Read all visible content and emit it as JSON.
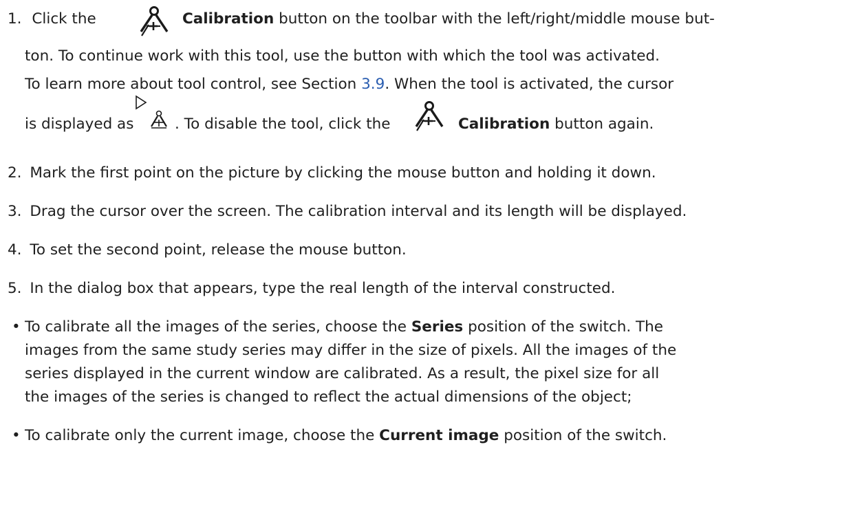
{
  "steps": [
    {
      "number": "1.",
      "line1_pre": "Click the",
      "line1_bold": "Calibration",
      "line1_post": "button on the toolbar with the left/right/middle mouse but-",
      "line2": "ton.  To continue work with this tool, use the button with which the tool was activated.",
      "line3_pre": "To learn more about tool control, see Section",
      "line3_link": "3.9",
      "line3_post": ". When the tool is activated, the cursor",
      "line4_pre": "is displayed as",
      "line4_mid": ". To disable the tool, click the",
      "line4_bold": "Calibration",
      "line4_post": "button again."
    },
    {
      "number": "2.",
      "text": "Mark the first point on the picture by clicking the mouse button and holding it down."
    },
    {
      "number": "3.",
      "text": "Drag the cursor over the screen. The calibration interval and its length will be displayed."
    },
    {
      "number": "4.",
      "text": "To set the second point, release the mouse button."
    },
    {
      "number": "5.",
      "text": "In the dialog box that appears, type the real length of the interval constructed."
    }
  ],
  "bullets": [
    {
      "marker": "•",
      "l1_pre": "To calibrate all the images of the series, choose the",
      "l1_bold": "Series",
      "l1_post": "position of the switch.  The",
      "l2": "images from the same study series may differ in the size of pixels.  All the images of the",
      "l3": "series displayed in the current window are calibrated.  As a result, the pixel size for all",
      "l4": "the images of the series is changed to reflect the actual dimensions of the object;"
    },
    {
      "marker": "•",
      "l1_pre": "To calibrate only the current image, choose the",
      "l1_bold": "Current image",
      "l1_post": "position of the switch."
    }
  ],
  "icons": {
    "calibration": "calibration-icon",
    "cursor": "calibration-cursor-icon"
  },
  "colors": {
    "text": "#1f1f1f",
    "link": "#2a5db0"
  }
}
